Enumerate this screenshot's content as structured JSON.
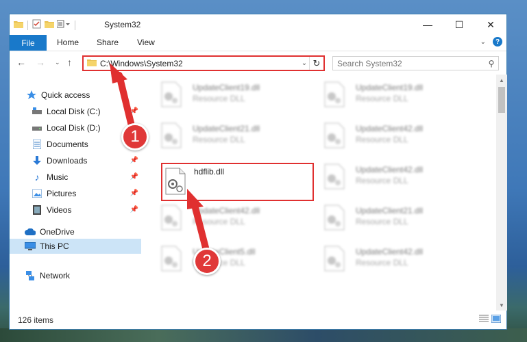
{
  "window": {
    "title": "System32"
  },
  "ribbon": {
    "file": "File",
    "tabs": [
      "Home",
      "Share",
      "View"
    ]
  },
  "address": {
    "path": "C:\\Windows\\System32"
  },
  "search": {
    "placeholder": "Search System32"
  },
  "sidebar": {
    "items": [
      {
        "label": "Quick access",
        "icon": "star-icon",
        "pinned": false
      },
      {
        "label": "Local Disk (C:)",
        "icon": "drive-icon",
        "pinned": true
      },
      {
        "label": "Local Disk (D:)",
        "icon": "drive-icon",
        "pinned": true
      },
      {
        "label": "Documents",
        "icon": "documents-icon",
        "pinned": true
      },
      {
        "label": "Downloads",
        "icon": "downloads-icon",
        "pinned": true
      },
      {
        "label": "Music",
        "icon": "music-icon",
        "pinned": true
      },
      {
        "label": "Pictures",
        "icon": "pictures-icon",
        "pinned": true
      },
      {
        "label": "Videos",
        "icon": "videos-icon",
        "pinned": true
      },
      {
        "label": "OneDrive",
        "icon": "cloud-icon",
        "pinned": false
      },
      {
        "label": "This PC",
        "icon": "computer-icon",
        "pinned": false,
        "selected": true
      },
      {
        "label": "Network",
        "icon": "network-icon",
        "pinned": false
      }
    ]
  },
  "files": {
    "col1": [
      {
        "name": "UpdateClient19.dll",
        "type": "Resource DLL"
      },
      {
        "name": "UpdateClient21.dll",
        "type": "Resource DLL"
      },
      {
        "name": "hdflib.dll",
        "type": ""
      },
      {
        "name": "UpdateClient42.dll",
        "type": "Resource DLL"
      },
      {
        "name": "UpdateClient5.dll",
        "type": "Resource DLL"
      }
    ],
    "col2": [
      {
        "name": "UpdateClient19.dll",
        "type": "Resource DLL"
      },
      {
        "name": "UpdateClient42.dll",
        "type": "Resource DLL"
      },
      {
        "name": "UpdateClient42.dll",
        "type": "Resource DLL"
      },
      {
        "name": "UpdateClient21.dll",
        "type": "Resource DLL"
      },
      {
        "name": "UpdateClient42.dll",
        "type": "Resource DLL"
      }
    ]
  },
  "status": {
    "count": "126 items"
  },
  "annotations": {
    "step1": "1",
    "step2": "2"
  },
  "colors": {
    "accent": "#1979ca",
    "highlight": "#e03030",
    "selected": "#cce4f7"
  }
}
